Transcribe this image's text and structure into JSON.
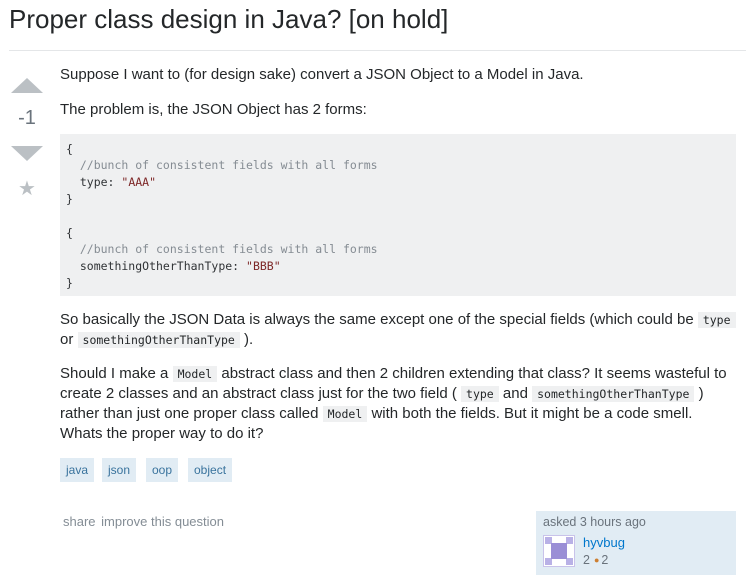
{
  "question": {
    "title": "Proper class design in Java? [on hold]",
    "score": "-1"
  },
  "body": {
    "p1": "Suppose I want to (for design sake) convert a JSON Object to a Model in Java.",
    "p2": "The problem is, the JSON Object has 2 forms:",
    "code": {
      "l1": "{",
      "l2": "  //bunch of consistent fields with all forms",
      "l3_key": "  type: ",
      "l3_val": "\"AAA\"",
      "l4": "}",
      "l5": "{",
      "l6": "  //bunch of consistent fields with all forms",
      "l7_key": "  somethingOtherThanType: ",
      "l7_val": "\"BBB\"",
      "l8": "}"
    },
    "p3": {
      "a": "So basically the JSON Data is always the same except one of the special fields (which could be ",
      "code1": "type",
      "b": " or ",
      "code2": "somethingOtherThanType",
      "c": " )."
    },
    "p4": {
      "a": "Should I make a ",
      "code1": "Model",
      "b": " abstract class and then 2 children extending that class? It seems wasteful to create 2 classes and an abstract class just for the two field ( ",
      "code2": "type",
      "c": " and ",
      "code3": "somethingOtherThanType",
      "d": " ) rather than just one proper class called ",
      "code4": "Model",
      "e": " with both the fields. But it might be a code smell. Whats the proper way to do it?"
    }
  },
  "tags": [
    "java",
    "json",
    "oop",
    "object"
  ],
  "menu": {
    "share": "share",
    "improve": "improve this question"
  },
  "owner": {
    "asked": "asked 3 hours ago",
    "username": "hyvbug",
    "reputation": "2",
    "bronze_count": "2"
  },
  "colors": {
    "link": "#0077cc",
    "tag_bg": "#e1ecf4",
    "tag_text": "#39739d",
    "code_bg": "#eff0f1",
    "bronze": "#cd7f32"
  }
}
